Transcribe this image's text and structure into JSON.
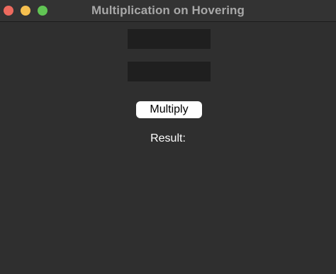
{
  "window": {
    "title": "Multiplication on Hovering",
    "controls": {
      "close_color": "#ed6a5e",
      "minimize_color": "#f5bf4f",
      "zoom_color": "#61c554"
    }
  },
  "form": {
    "first_value": "",
    "second_value": "",
    "multiply_label": "Multiply",
    "result_label": "Result:"
  }
}
